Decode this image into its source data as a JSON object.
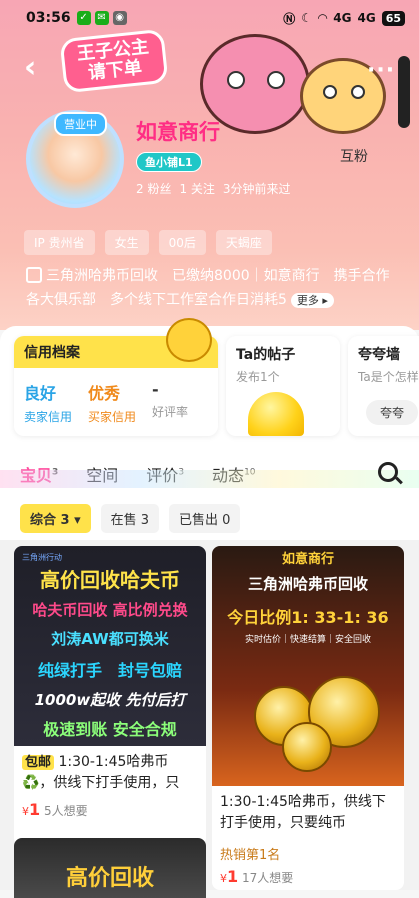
{
  "status_bar": {
    "time": "03:56",
    "battery": "65",
    "signal1": "4G",
    "signal2": "4G"
  },
  "banner": {
    "badge_line1": "王子公主",
    "badge_line2": "请下单",
    "follow_label": "互粉"
  },
  "profile": {
    "avatar_badge": "营业中",
    "name": "如意商行",
    "level": "鱼小铺L1",
    "fans": "2 粉丝",
    "following": "1 关注",
    "last_active": "3分钟前来过",
    "tags": [
      "IP 贵州省",
      "女生",
      "00后",
      "天蝎座"
    ],
    "bio": "三角洲哈弗币回收　已缴纳8000｜如意商行　携手合作各大俱乐部　多个线下工作室合作日消耗5",
    "bio_more": "更多 ▸"
  },
  "cards": {
    "credit": {
      "title": "信用档案",
      "items": [
        {
          "value": "良好",
          "label": "卖家信用",
          "color": "#2aa4e6"
        },
        {
          "value": "优秀",
          "label": "买家信用",
          "color": "#f08a1c"
        },
        {
          "value": "-",
          "label": "好评率",
          "color": "#333333"
        }
      ]
    },
    "posts": {
      "title": "Ta的帖子",
      "sub": "发布1个"
    },
    "praise": {
      "title": "夸夸墙",
      "sub": "Ta是个怎样",
      "button": "夸夸"
    }
  },
  "tabs": [
    {
      "label": "宝贝",
      "count": "3"
    },
    {
      "label": "空间",
      "count": ""
    },
    {
      "label": "评价",
      "count": "3"
    },
    {
      "label": "动态",
      "count": "10"
    }
  ],
  "filters": {
    "all": "综合 3 ▾",
    "on_sale": "在售 3",
    "sold": "已售出 0"
  },
  "items": [
    {
      "image_lines": [
        "高价回收哈夫币",
        "哈夫币回收 高比例兑换",
        "刘涛AW都可换米",
        "纯绿打手　封号包赔",
        "1000w起收 先付后打",
        "极速到账 安全合规"
      ],
      "image_brand": "三角洲行动",
      "badge": "包邮",
      "title": "1:30-1:45哈弗币♻️，供线下打手使用，只",
      "price": "1",
      "wants": "5人想要"
    },
    {
      "image_brand": "如意商行",
      "image_headline": "三角洲哈弗币回收",
      "image_ratio": "今日比例1: 33-1: 36",
      "image_tags": "实时估价｜快速结算｜安全回收",
      "title": "1:30-1:45哈弗币，供线下打手使用，只要纯币",
      "hot": "热销第1名",
      "price": "1",
      "wants": "17人想要"
    },
    {
      "image_text": "高价回收"
    }
  ]
}
